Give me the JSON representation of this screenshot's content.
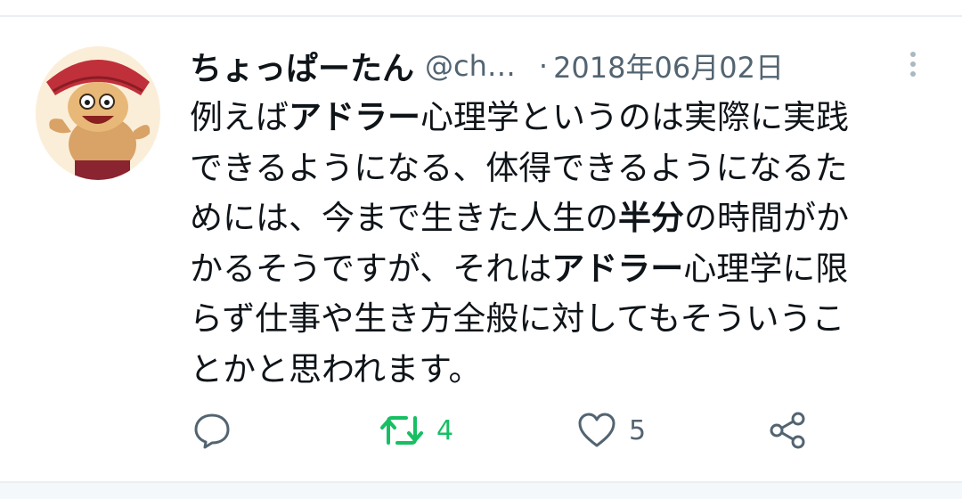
{
  "tweet": {
    "author_display_name": "ちょっぱーたん",
    "author_handle": "@ch…",
    "separator": "·",
    "date": "2018年06月02日",
    "text_lines": [
      [
        {
          "t": "例えば",
          "b": false
        },
        {
          "t": "アドラー",
          "b": true
        },
        {
          "t": "心理学というのは実際に実践",
          "b": false
        }
      ],
      [
        {
          "t": "できるようになる、体得できるようになるた",
          "b": false
        }
      ],
      [
        {
          "t": "めには、今まで生きた人生の",
          "b": false
        },
        {
          "t": "半分",
          "b": true
        },
        {
          "t": "の時間がか",
          "b": false
        }
      ],
      [
        {
          "t": "かるそうですが、それは",
          "b": false
        },
        {
          "t": "アドラー",
          "b": true
        },
        {
          "t": "心理学に限",
          "b": false
        }
      ],
      [
        {
          "t": "らず仕事や生き方全般に対してもそういうこ",
          "b": false
        }
      ],
      [
        {
          "t": "とかと思われます。",
          "b": false
        }
      ]
    ]
  },
  "actions": {
    "reply": {
      "icon": "reply-icon",
      "count": ""
    },
    "retweet": {
      "icon": "retweet-icon",
      "count": "4",
      "color": "#17bf63"
    },
    "like": {
      "icon": "heart-icon",
      "count": "5"
    },
    "share": {
      "icon": "share-icon"
    }
  },
  "colors": {
    "text": "#0f1419",
    "secondary": "#536471",
    "retweet_active": "#17bf63"
  }
}
